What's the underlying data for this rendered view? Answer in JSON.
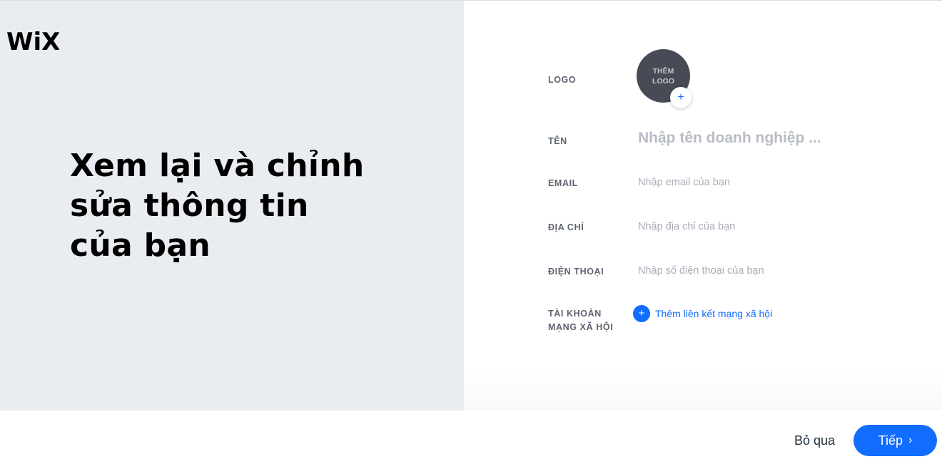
{
  "brand": {
    "logo_text": "WiX"
  },
  "left": {
    "headline": "Xem lại và chỉnh sửa thông tin của bạn"
  },
  "form": {
    "logo": {
      "label": "LOGO",
      "placeholder_line1": "THÊM",
      "placeholder_line2": "LOGO",
      "add_icon": "plus-icon"
    },
    "name": {
      "label": "TÊN",
      "placeholder": "Nhập tên doanh nghiệp ..."
    },
    "email": {
      "label": "EMAIL",
      "placeholder": "Nhập email của bạn"
    },
    "address": {
      "label": "ĐỊA CHỈ",
      "placeholder": "Nhập địa chỉ của bạn"
    },
    "phone": {
      "label": "ĐIỆN THOẠI",
      "placeholder": "Nhập số điện thoại của bạn"
    },
    "social": {
      "label_line1": "TÀI KHOẢN",
      "label_line2": "MẠNG XÃ HỘI",
      "link_text": "Thêm liên kết mạng xã hội",
      "add_icon": "plus-icon"
    }
  },
  "footer": {
    "skip_label": "Bỏ qua",
    "next_label": "Tiếp",
    "next_icon": "chevron-right-icon"
  },
  "colors": {
    "accent": "#116dff",
    "left_panel_bg": "#e9ecf1",
    "logo_circle_bg": "#464b55"
  }
}
